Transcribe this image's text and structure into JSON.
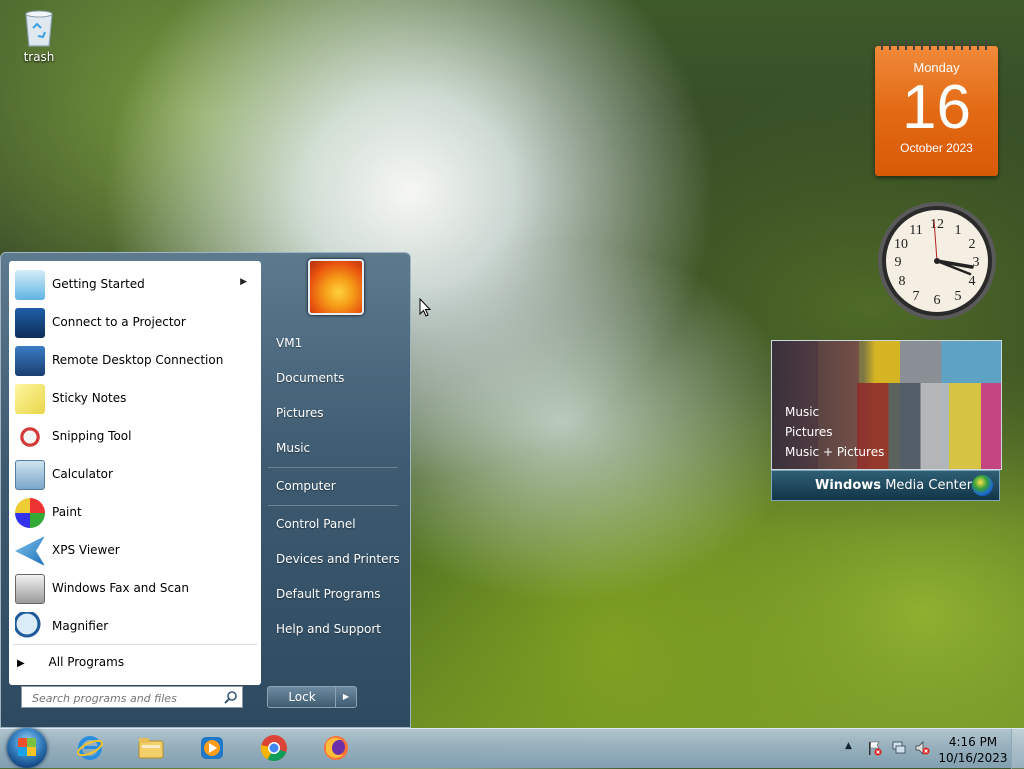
{
  "desktop": {
    "icons": [
      {
        "label": "trash",
        "icon": "recycle-bin-icon"
      }
    ]
  },
  "calendar_gadget": {
    "weekday": "Monday",
    "day": "16",
    "month_year": "October 2023",
    "color": "#e36a14"
  },
  "clock_gadget": {
    "hour": 4,
    "minute": 16
  },
  "media_center_gadget": {
    "menu": [
      "Music",
      "Pictures",
      "Music + Pictures"
    ],
    "brand_prefix": "Windows",
    "brand_suffix": "Media Center"
  },
  "start_menu": {
    "programs": [
      {
        "label": "Getting Started",
        "icon": "getting-started-icon",
        "has_submenu": true
      },
      {
        "label": "Connect to a Projector",
        "icon": "projector-icon"
      },
      {
        "label": "Remote Desktop Connection",
        "icon": "remote-desktop-icon"
      },
      {
        "label": "Sticky Notes",
        "icon": "sticky-notes-icon"
      },
      {
        "label": "Snipping Tool",
        "icon": "snipping-tool-icon"
      },
      {
        "label": "Calculator",
        "icon": "calculator-icon"
      },
      {
        "label": "Paint",
        "icon": "paint-icon"
      },
      {
        "label": "XPS Viewer",
        "icon": "xps-viewer-icon"
      },
      {
        "label": "Windows Fax and Scan",
        "icon": "fax-scan-icon"
      },
      {
        "label": "Magnifier",
        "icon": "magnifier-icon"
      }
    ],
    "all_programs": "All Programs",
    "search_placeholder": "Search programs and files",
    "right_links": [
      "VM1",
      "Documents",
      "Pictures",
      "Music",
      "Computer",
      "Control Panel",
      "Devices and Printers",
      "Default Programs",
      "Help and Support"
    ],
    "lock_label": "Lock"
  },
  "taskbar": {
    "pinned": [
      "internet-explorer-icon",
      "file-explorer-icon",
      "media-player-icon",
      "chrome-icon",
      "firefox-icon"
    ],
    "time": "4:16 PM",
    "date": "10/16/2023"
  }
}
